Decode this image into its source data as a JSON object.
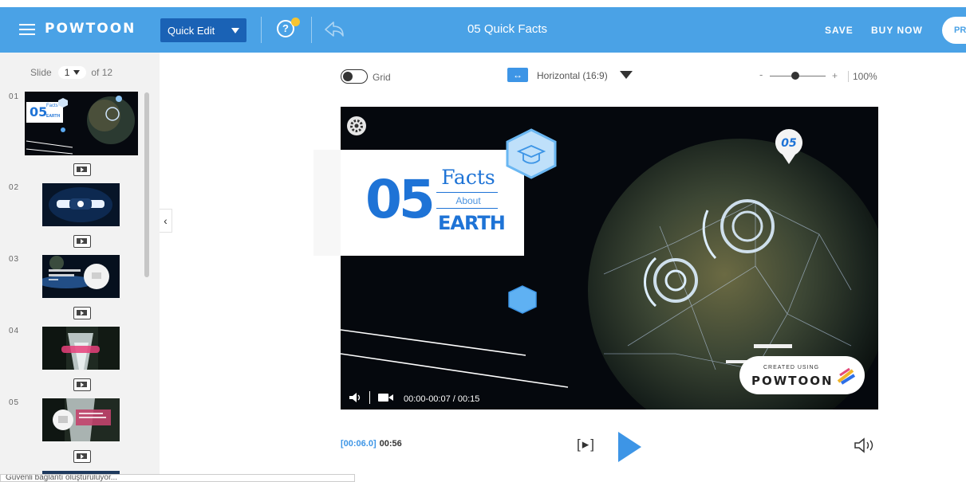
{
  "header": {
    "logo": "POWTOON",
    "mode_label": "Quick Edit",
    "doc_title": "05 Quick Facts",
    "save_label": "SAVE",
    "buy_label": "BUY NOW",
    "preview_label": "PRE",
    "help_glyph": "?",
    "bg_color": "#4aa2e6",
    "accent_color": "#1a62b5"
  },
  "sidebar": {
    "slide_label": "Slide",
    "current_slide": "1",
    "of_label": "of 12",
    "slides": [
      {
        "num": "01",
        "thumb_title": "05",
        "thumb_sub": "Facts",
        "thumb_word": "EARTH"
      },
      {
        "num": "02"
      },
      {
        "num": "03"
      },
      {
        "num": "04"
      },
      {
        "num": "05"
      }
    ],
    "collapse_glyph": "‹",
    "status_text": "Güvenli bağlantı oluşturuluyor..."
  },
  "toolbar": {
    "grid_label": "Grid",
    "ratio_glyph": "↔",
    "ratio_label": "Horizontal (16:9)",
    "zoom_minus": "-",
    "zoom_plus": "+",
    "zoom_value": "100%",
    "zoom_level": 0.45
  },
  "canvas": {
    "title_number": "05",
    "title_word1": "Facts",
    "title_word2": "About",
    "title_word3": "EARTH",
    "pin_label": "05",
    "created_using": "CREATED USING",
    "watermark_logo": "POWTOON",
    "player_time": "00:00-00:07 / 00:15",
    "title_color": "#1e73d6"
  },
  "playback": {
    "current_time": "[00:06.0]",
    "duration": "00:56",
    "frame_step": "[▸]"
  },
  "icons": [
    "menu-icon",
    "help-icon",
    "undo-icon",
    "gear-icon",
    "graduation-cap-icon",
    "hexagon-icon",
    "pin-icon",
    "speaker-icon",
    "camera-icon",
    "play-icon",
    "insert-slide-icon",
    "chevron-left-icon"
  ]
}
